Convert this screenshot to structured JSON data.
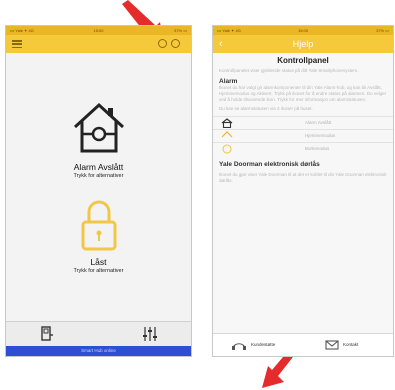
{
  "status_bar": {
    "carrier": "••• Yale ✦ 4G",
    "time": "15:00",
    "battery": "37% ▭"
  },
  "control_panel": {
    "alarm": {
      "status": "Alarm Avslått",
      "hint": "Trykk for alternativer"
    },
    "lock": {
      "status": "Låst",
      "hint": "Trykk for alternativer"
    },
    "connection_status": "Smart Hub online"
  },
  "help": {
    "title": "Hjelp",
    "section_title": "Kontrollpanel",
    "intro": "Kontrollpanelet viser gjeldende status på ditt Yale Smartphonesystem.",
    "alarm_heading": "Alarm",
    "alarm_text": "Ikonet du har valgt gir alarmkomponenter til din Yale Alarm-hub, og kan bli Avslått, Hjemmemodus og Aktivert. Trykk på ikonet for å endre status på alarmen. Du velger ved å holde tilsvarende ikon. Trykk for mer informasjon om alarmstatusen.",
    "states_intro": "Du kan se alarmstatusen via 3 ikoner på huset.",
    "states": [
      {
        "icon": "house-armed-icon",
        "label": "Alarm Avslått"
      },
      {
        "icon": "house-home-icon",
        "label": "Hjemmemodus"
      },
      {
        "icon": "house-away-icon",
        "label": "Bortemodus"
      }
    ],
    "doorman_heading": "Yale Doorman elektronisk dørlås",
    "doorman_text": "Ikonet du gjør viser Yale Doorman til at det er koblet til din Yale Doorman elektronisk dørlås.",
    "bottom": {
      "user_manual": "Kundestøtte",
      "contact": "Kontakt"
    }
  },
  "colors": {
    "navbar": "#f6c93b",
    "status": "#e9b626",
    "lock": "#f2c744",
    "connection": "#2c4fd6",
    "arrow": "#e52b2b"
  }
}
